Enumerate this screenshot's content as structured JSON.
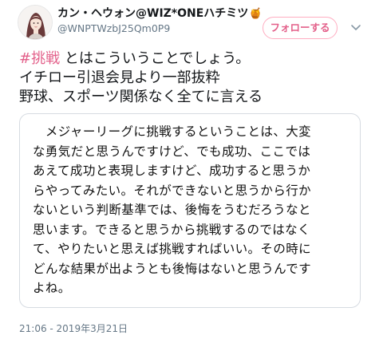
{
  "author": {
    "display_name": "カン・ヘウォン@WIZ*ONEハチミツ",
    "badge_emoji": "🍯",
    "handle": "@WNPTWzbJ25Qm0P9"
  },
  "follow_button": {
    "label": "フォローする"
  },
  "tweet": {
    "hashtag": "#挑戦",
    "line1_rest": " とはこういうことでしょう。",
    "line2": "イチロー引退会見より一部抜粋",
    "line3": "野球、スポーツ関係なく全てに言える"
  },
  "attachment": {
    "lines": [
      "　メジャーリーグに挑戦するということは、大変",
      "な勇気だと思うんですけど、でも成功、ここでは",
      "あえて成功と表現しますけど、成功すると思うか",
      "らやってみたい。それができないと思うから行か",
      "ないという判断基準では、後悔をうむだろうなと",
      "思います。できると思うから挑戦するのではなく",
      "て、やりたいと思えば挑戦すればいい。その時に",
      "どんな結果が出ようとも後悔はないと思うんです",
      "よね。"
    ]
  },
  "timestamp": "21:06 - 2019年3月21日",
  "colors": {
    "accent": "#e3608a",
    "button_border": "#ffadc1",
    "secondary_text": "#657786",
    "card_border": "#d6dbe1"
  },
  "icons": {
    "avatar": "illustrated-portrait",
    "menu": "chevron-down-icon"
  }
}
